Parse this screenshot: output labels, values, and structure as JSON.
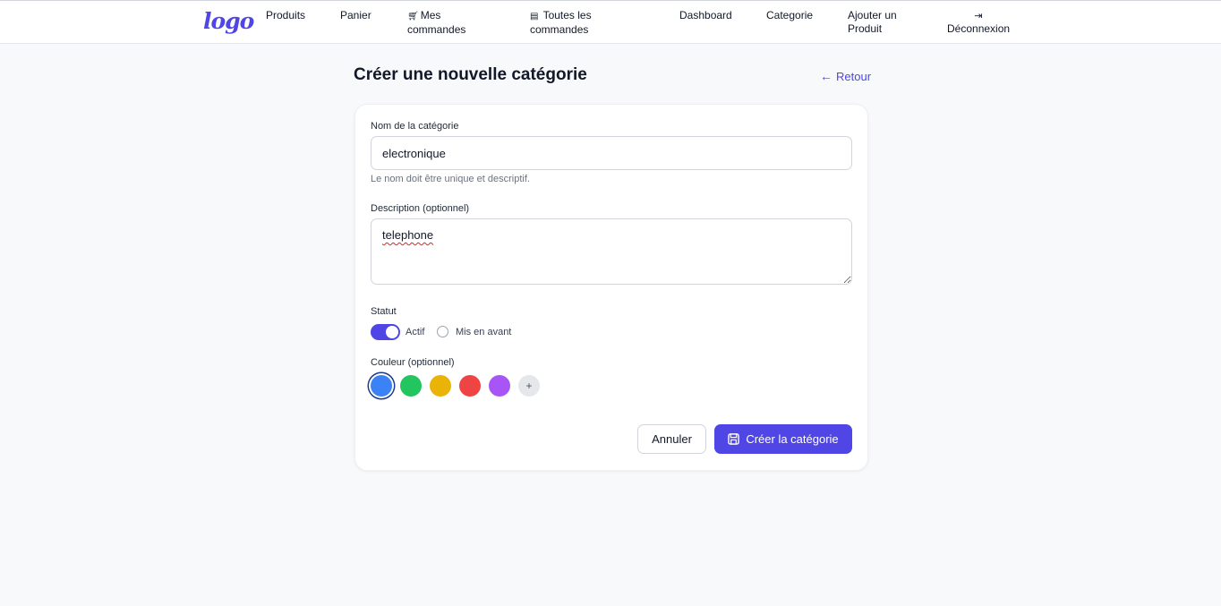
{
  "nav": {
    "logo": "logo",
    "items": [
      {
        "label": "Produits"
      },
      {
        "label": "Panier"
      },
      {
        "label": "Mes commandes",
        "icon": "cart-icon"
      },
      {
        "label": "Toutes les commandes",
        "icon": "list-icon"
      },
      {
        "label": "Dashboard"
      },
      {
        "label": "Categorie"
      },
      {
        "label": "Ajouter un Produit"
      },
      {
        "label": "Déconnexion",
        "icon": "logout-icon"
      }
    ]
  },
  "header": {
    "title": "Créer une nouvelle catégorie",
    "back_label": "Retour"
  },
  "form": {
    "name_label": "Nom de la catégorie",
    "name_value": "electronique",
    "name_hint": "Le nom doit être unique et descriptif.",
    "description_label": "Description (optionnel)",
    "description_value": "telephone",
    "status_label": "Statut",
    "active_label": "Actif",
    "active_on": true,
    "featured_label": "Mis en avant",
    "featured_checked": false,
    "color_label": "Couleur (optionnel)",
    "colors": [
      "#3b82f6",
      "#22c55e",
      "#eab308",
      "#ef4444",
      "#a855f7"
    ],
    "selected_color": "#3b82f6",
    "add_color_label": "+",
    "cancel_label": "Annuler",
    "submit_label": "Créer la catégorie"
  },
  "theme": {
    "accent": "#4f46e5",
    "background": "#f8f9fb"
  }
}
